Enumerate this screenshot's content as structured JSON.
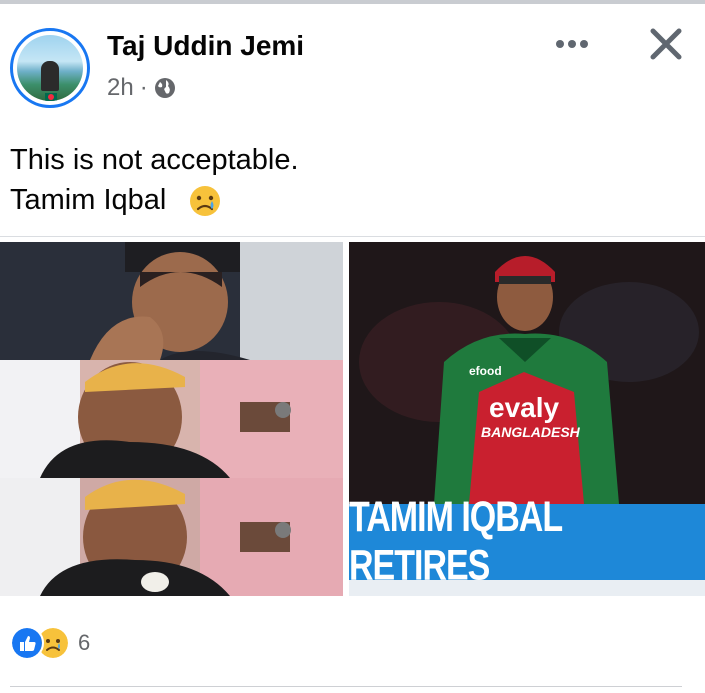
{
  "post": {
    "author": "Taj Uddin Jemi",
    "time": "2h",
    "separator": "·",
    "text_line1": "This is not acceptable.",
    "text_line2": "Tamim Iqbal"
  },
  "icons": {
    "more": "more-horizontal-icon",
    "close": "close-icon",
    "privacy": "globe-icon",
    "emoji": "crying-face-emoji",
    "like": "like-reaction-icon",
    "sad": "sad-reaction-icon"
  },
  "images": {
    "right_banner": "TAMIM IQBAL RETIRES",
    "jersey_sponsor": "evaly",
    "jersey_country": "BANGLADESH",
    "jersey_brand": "efood"
  },
  "reactions": {
    "count": "6"
  },
  "colors": {
    "accent": "#1877f2",
    "banner": "#1e88d8",
    "secondary_text": "#65676b"
  }
}
